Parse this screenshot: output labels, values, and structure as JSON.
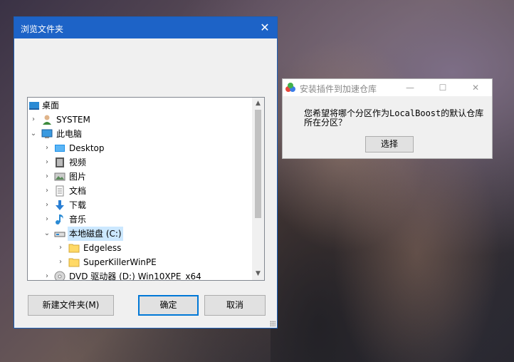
{
  "dialog": {
    "title": "浏览文件夹",
    "close_glyph": "✕",
    "tree": [
      {
        "label": "桌面",
        "icon": "desktop-icon",
        "level": 0,
        "chevron": "",
        "selected": false
      },
      {
        "label": "SYSTEM",
        "icon": "user-icon",
        "level": 1,
        "chevron": "›",
        "selected": false
      },
      {
        "label": "此电脑",
        "icon": "computer-icon",
        "level": 1,
        "chevron": "⌄",
        "selected": false
      },
      {
        "label": "Desktop",
        "icon": "desktop-folder-icon",
        "level": 2,
        "chevron": "›",
        "selected": false
      },
      {
        "label": "视频",
        "icon": "video-icon",
        "level": 2,
        "chevron": "›",
        "selected": false
      },
      {
        "label": "图片",
        "icon": "pictures-icon",
        "level": 2,
        "chevron": "›",
        "selected": false
      },
      {
        "label": "文档",
        "icon": "documents-icon",
        "level": 2,
        "chevron": "›",
        "selected": false
      },
      {
        "label": "下载",
        "icon": "download-icon",
        "level": 2,
        "chevron": "›",
        "selected": false
      },
      {
        "label": "音乐",
        "icon": "music-icon",
        "level": 2,
        "chevron": "›",
        "selected": false
      },
      {
        "label": "本地磁盘 (C:)",
        "icon": "drive-icon",
        "level": 2,
        "chevron": "⌄",
        "selected": true
      },
      {
        "label": "Edgeless",
        "icon": "folder-icon",
        "level": 3,
        "chevron": "›",
        "selected": false
      },
      {
        "label": "SuperKillerWinPE",
        "icon": "folder-icon",
        "level": 3,
        "chevron": "›",
        "selected": false
      },
      {
        "label": "DVD 驱动器 (D:) Win10XPE_x64",
        "icon": "dvd-icon",
        "level": 2,
        "chevron": "›",
        "selected": false
      }
    ],
    "new_folder_label": "新建文件夹(M)",
    "ok_label": "确定",
    "cancel_label": "取消"
  },
  "window2": {
    "title": "安装插件到加速仓库",
    "minimize_glyph": "—",
    "maximize_glyph": "☐",
    "close_glyph": "✕",
    "message_line1": "您希望将哪个分区作为LocalBoost的默认仓库",
    "message_line2": "所在分区？",
    "select_label": "选择"
  }
}
